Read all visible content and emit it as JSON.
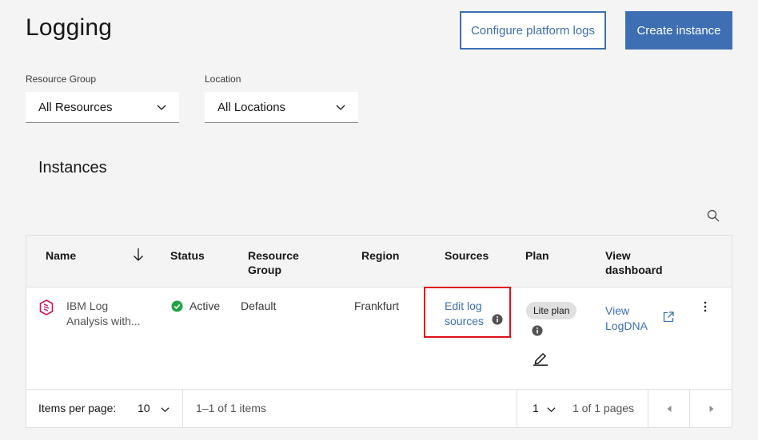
{
  "page": {
    "title": "Logging",
    "configure_button": "Configure platform logs",
    "create_button": "Create instance"
  },
  "filters": {
    "resource_group": {
      "label": "Resource Group",
      "value": "All Resources"
    },
    "location": {
      "label": "Location",
      "value": "All Locations"
    }
  },
  "instances": {
    "title": "Instances",
    "columns": {
      "name": "Name",
      "status": "Status",
      "resource_group_line1": "Resource",
      "resource_group_line2": "Group",
      "region": "Region",
      "sources": "Sources",
      "plan": "Plan",
      "view_line1": "View",
      "view_line2": "dashboard"
    },
    "row": {
      "name_line1": "IBM Log",
      "name_line2": "Analysis with...",
      "status": "Active",
      "resource_group": "Default",
      "region": "Frankfurt",
      "sources_line1": "Edit log",
      "sources_line2": "sources",
      "plan": "Lite plan",
      "view_line1": "View",
      "view_line2": "LogDNA"
    },
    "pagination": {
      "items_per_page_label": "Items per page:",
      "items_per_page": "10",
      "range": "1–1 of 1 items",
      "page": "1",
      "pages": "1 of 1 pages"
    }
  },
  "colors": {
    "primary": "#3e6fb3",
    "active_status": "#24a148",
    "highlight": "#e0101a",
    "logo": "#d0105c"
  }
}
